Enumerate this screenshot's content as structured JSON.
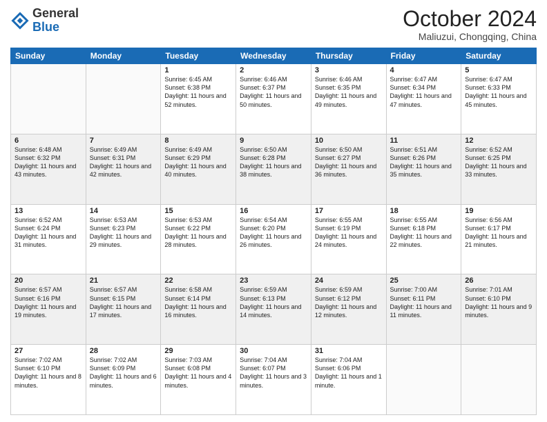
{
  "header": {
    "logo_line1": "General",
    "logo_line2": "Blue",
    "month": "October 2024",
    "location": "Maliuzui, Chongqing, China"
  },
  "weekdays": [
    "Sunday",
    "Monday",
    "Tuesday",
    "Wednesday",
    "Thursday",
    "Friday",
    "Saturday"
  ],
  "weeks": [
    [
      null,
      null,
      {
        "day": 1,
        "sunrise": "6:45 AM",
        "sunset": "6:38 PM",
        "daylight": "11 hours and 52 minutes."
      },
      {
        "day": 2,
        "sunrise": "6:46 AM",
        "sunset": "6:37 PM",
        "daylight": "11 hours and 50 minutes."
      },
      {
        "day": 3,
        "sunrise": "6:46 AM",
        "sunset": "6:35 PM",
        "daylight": "11 hours and 49 minutes."
      },
      {
        "day": 4,
        "sunrise": "6:47 AM",
        "sunset": "6:34 PM",
        "daylight": "11 hours and 47 minutes."
      },
      {
        "day": 5,
        "sunrise": "6:47 AM",
        "sunset": "6:33 PM",
        "daylight": "11 hours and 45 minutes."
      }
    ],
    [
      {
        "day": 6,
        "sunrise": "6:48 AM",
        "sunset": "6:32 PM",
        "daylight": "11 hours and 43 minutes."
      },
      {
        "day": 7,
        "sunrise": "6:49 AM",
        "sunset": "6:31 PM",
        "daylight": "11 hours and 42 minutes."
      },
      {
        "day": 8,
        "sunrise": "6:49 AM",
        "sunset": "6:29 PM",
        "daylight": "11 hours and 40 minutes."
      },
      {
        "day": 9,
        "sunrise": "6:50 AM",
        "sunset": "6:28 PM",
        "daylight": "11 hours and 38 minutes."
      },
      {
        "day": 10,
        "sunrise": "6:50 AM",
        "sunset": "6:27 PM",
        "daylight": "11 hours and 36 minutes."
      },
      {
        "day": 11,
        "sunrise": "6:51 AM",
        "sunset": "6:26 PM",
        "daylight": "11 hours and 35 minutes."
      },
      {
        "day": 12,
        "sunrise": "6:52 AM",
        "sunset": "6:25 PM",
        "daylight": "11 hours and 33 minutes."
      }
    ],
    [
      {
        "day": 13,
        "sunrise": "6:52 AM",
        "sunset": "6:24 PM",
        "daylight": "11 hours and 31 minutes."
      },
      {
        "day": 14,
        "sunrise": "6:53 AM",
        "sunset": "6:23 PM",
        "daylight": "11 hours and 29 minutes."
      },
      {
        "day": 15,
        "sunrise": "6:53 AM",
        "sunset": "6:22 PM",
        "daylight": "11 hours and 28 minutes."
      },
      {
        "day": 16,
        "sunrise": "6:54 AM",
        "sunset": "6:20 PM",
        "daylight": "11 hours and 26 minutes."
      },
      {
        "day": 17,
        "sunrise": "6:55 AM",
        "sunset": "6:19 PM",
        "daylight": "11 hours and 24 minutes."
      },
      {
        "day": 18,
        "sunrise": "6:55 AM",
        "sunset": "6:18 PM",
        "daylight": "11 hours and 22 minutes."
      },
      {
        "day": 19,
        "sunrise": "6:56 AM",
        "sunset": "6:17 PM",
        "daylight": "11 hours and 21 minutes."
      }
    ],
    [
      {
        "day": 20,
        "sunrise": "6:57 AM",
        "sunset": "6:16 PM",
        "daylight": "11 hours and 19 minutes."
      },
      {
        "day": 21,
        "sunrise": "6:57 AM",
        "sunset": "6:15 PM",
        "daylight": "11 hours and 17 minutes."
      },
      {
        "day": 22,
        "sunrise": "6:58 AM",
        "sunset": "6:14 PM",
        "daylight": "11 hours and 16 minutes."
      },
      {
        "day": 23,
        "sunrise": "6:59 AM",
        "sunset": "6:13 PM",
        "daylight": "11 hours and 14 minutes."
      },
      {
        "day": 24,
        "sunrise": "6:59 AM",
        "sunset": "6:12 PM",
        "daylight": "11 hours and 12 minutes."
      },
      {
        "day": 25,
        "sunrise": "7:00 AM",
        "sunset": "6:11 PM",
        "daylight": "11 hours and 11 minutes."
      },
      {
        "day": 26,
        "sunrise": "7:01 AM",
        "sunset": "6:10 PM",
        "daylight": "11 hours and 9 minutes."
      }
    ],
    [
      {
        "day": 27,
        "sunrise": "7:02 AM",
        "sunset": "6:10 PM",
        "daylight": "11 hours and 8 minutes."
      },
      {
        "day": 28,
        "sunrise": "7:02 AM",
        "sunset": "6:09 PM",
        "daylight": "11 hours and 6 minutes."
      },
      {
        "day": 29,
        "sunrise": "7:03 AM",
        "sunset": "6:08 PM",
        "daylight": "11 hours and 4 minutes."
      },
      {
        "day": 30,
        "sunrise": "7:04 AM",
        "sunset": "6:07 PM",
        "daylight": "11 hours and 3 minutes."
      },
      {
        "day": 31,
        "sunrise": "7:04 AM",
        "sunset": "6:06 PM",
        "daylight": "11 hours and 1 minute."
      },
      null,
      null
    ]
  ]
}
